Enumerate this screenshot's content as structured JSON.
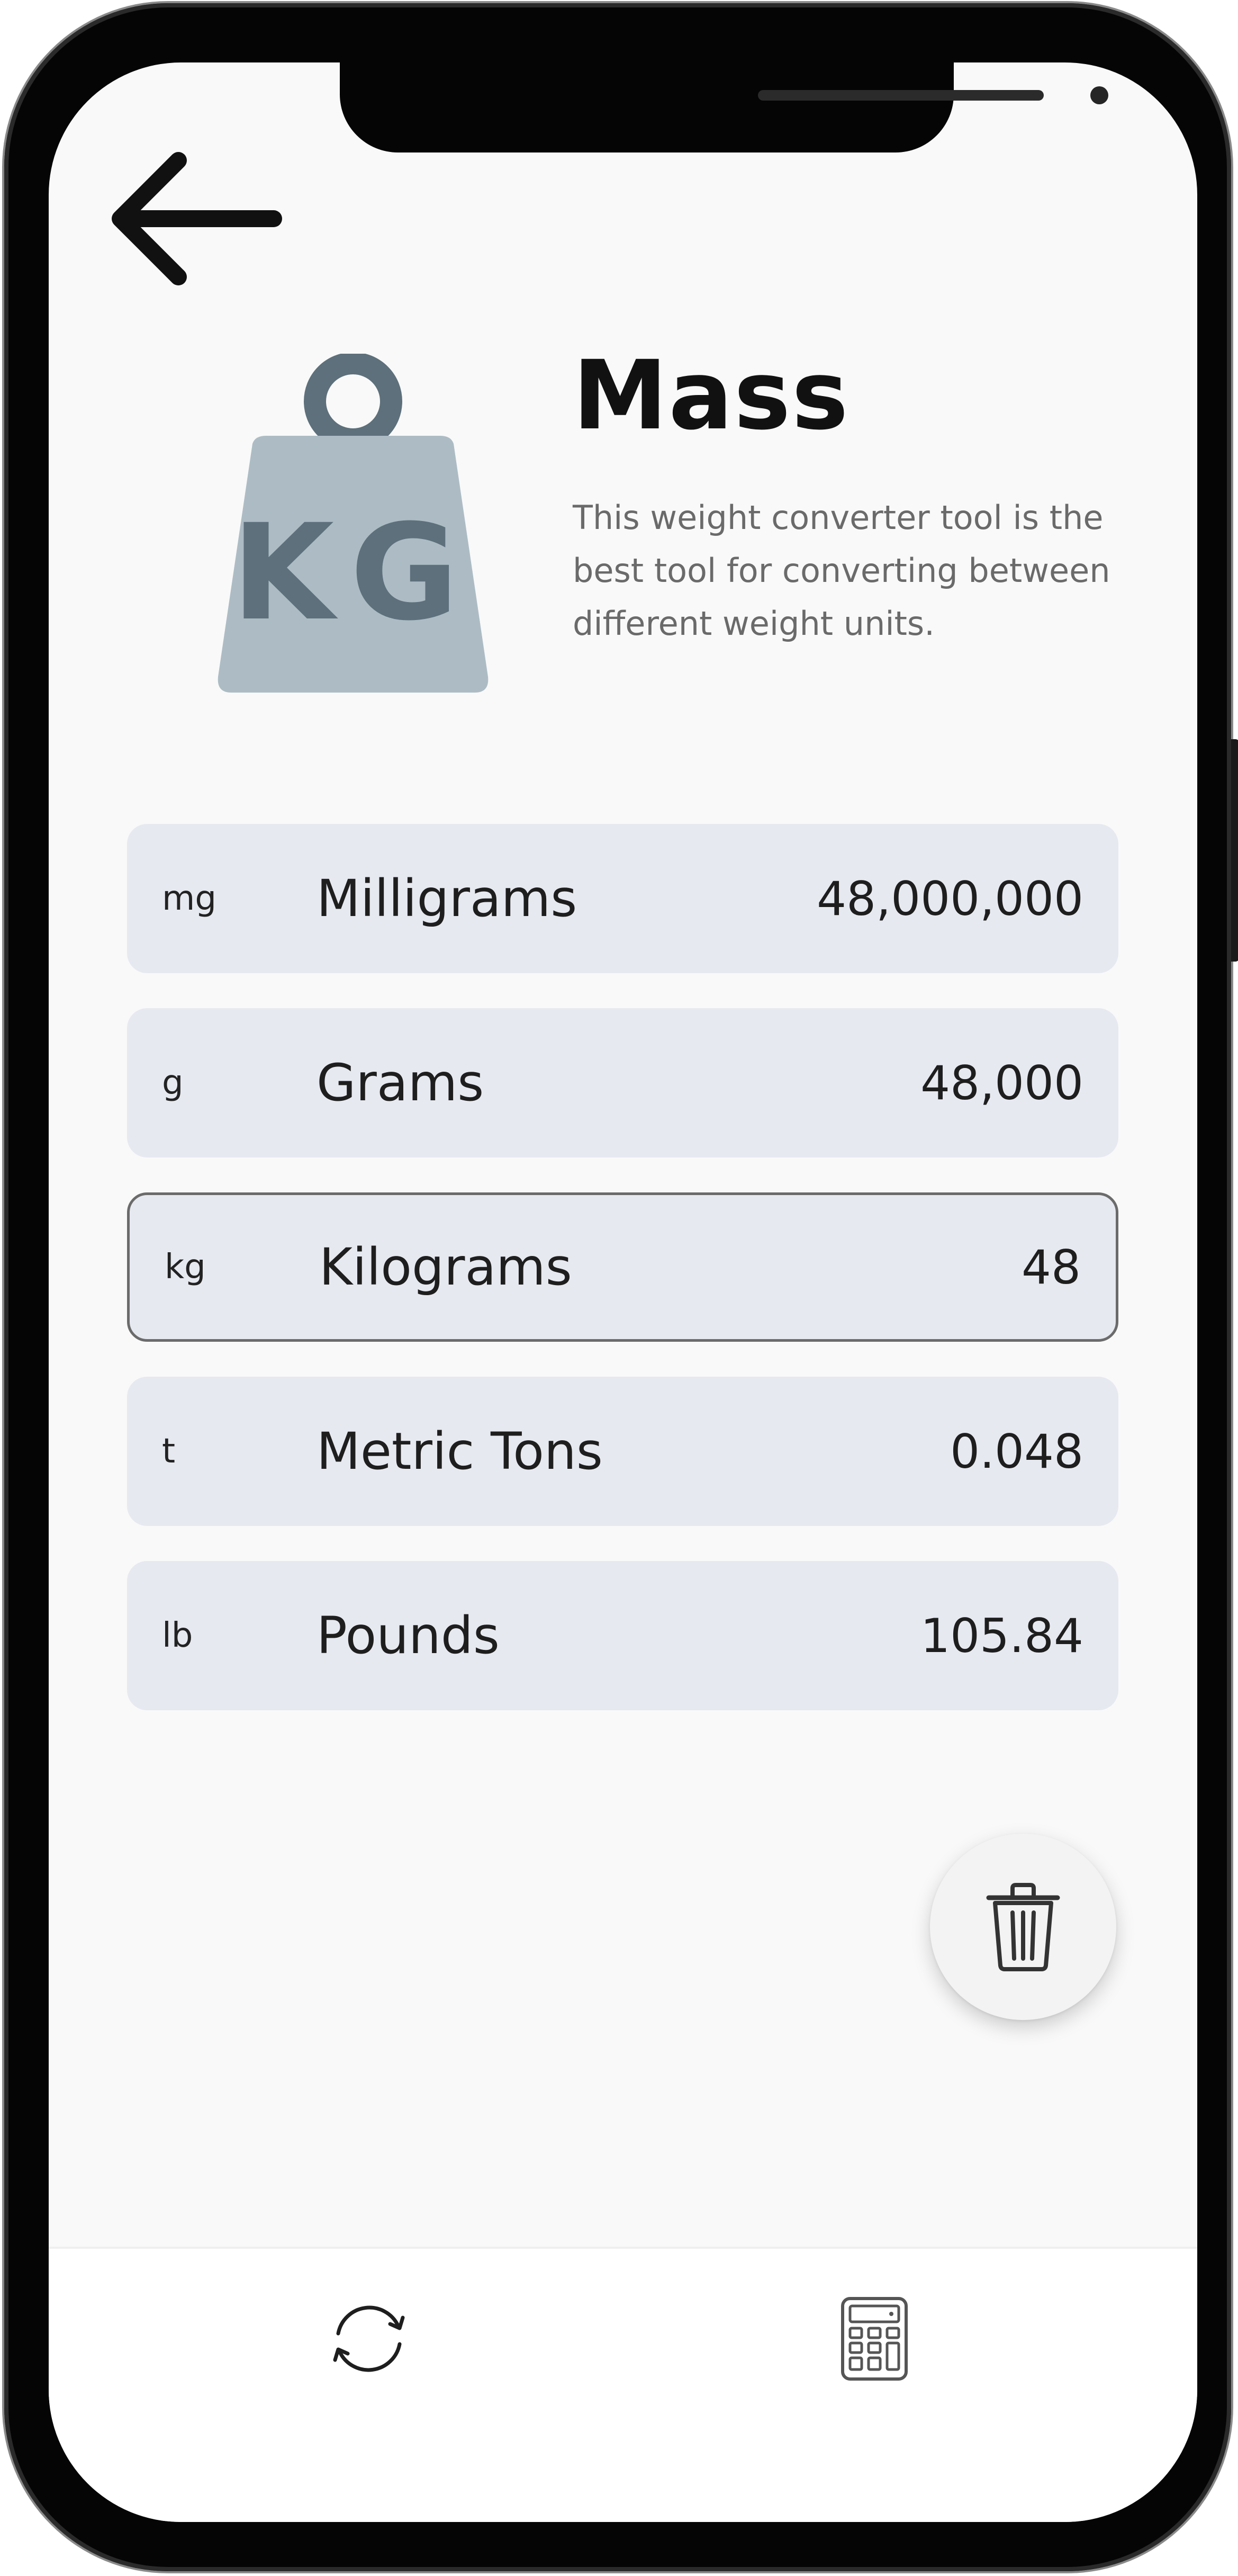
{
  "header": {
    "back_icon": "arrow-left-icon"
  },
  "hero": {
    "illustration_icon": "kg-weight-icon",
    "illustration_text": "KG",
    "title": "Mass",
    "description": "This weight converter tool is the best tool for converting between different weight units."
  },
  "units": [
    {
      "abbr": "mg",
      "name": "Milligrams",
      "value": "48,000,000",
      "selected": false
    },
    {
      "abbr": "g",
      "name": "Grams",
      "value": "48,000",
      "selected": false
    },
    {
      "abbr": "kg",
      "name": "Kilograms",
      "value": "48",
      "selected": true
    },
    {
      "abbr": "t",
      "name": "Metric Tons",
      "value": "0.048",
      "selected": false
    },
    {
      "abbr": "lb",
      "name": "Pounds",
      "value": "105.84",
      "selected": false
    }
  ],
  "actions": {
    "delete_icon": "trash-icon"
  },
  "bottom_nav": {
    "items": [
      {
        "icon": "convert-refresh-icon"
      },
      {
        "icon": "calculator-icon"
      }
    ]
  },
  "colors": {
    "background": "#f9f9f9",
    "row_background": "#e7e9f1",
    "selected_border": "#6b6b6b",
    "weight_body": "#adbcc4",
    "weight_dark": "#5d707b",
    "text_primary": "#111111",
    "text_secondary": "#6a6a6a"
  }
}
